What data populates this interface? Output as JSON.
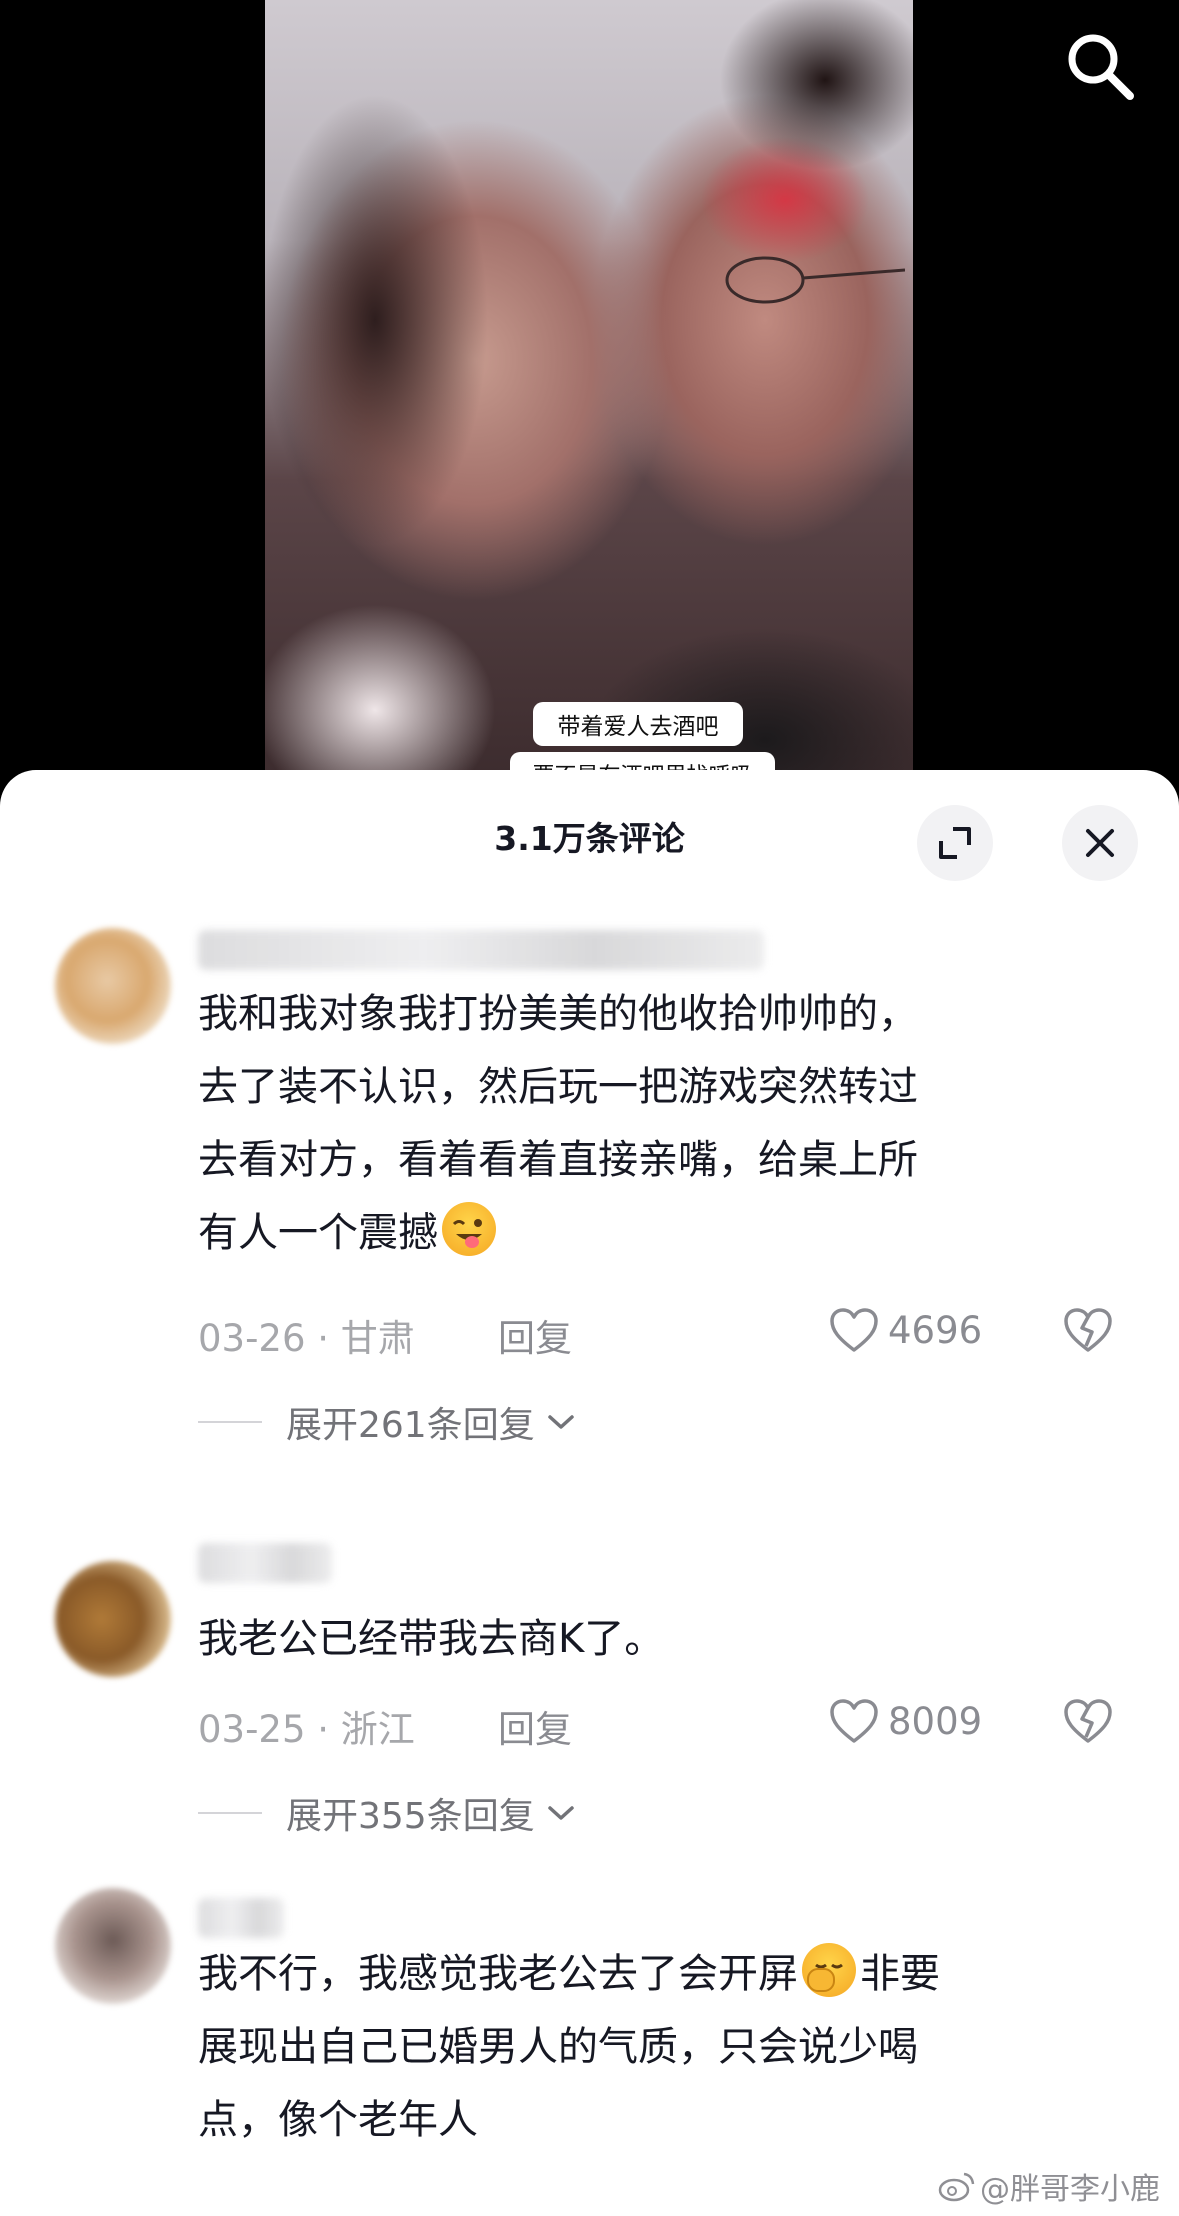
{
  "video": {
    "caption_line1": "带着爱人去酒吧",
    "caption_line2": "要不是在酒吧里找呼吸"
  },
  "icons": {
    "search": "search-icon",
    "expand": "expand-icon",
    "close": "close-icon",
    "like": "heart-outline-icon",
    "dislike": "broken-heart-icon",
    "chevron": "chevron-down-icon"
  },
  "comments_panel": {
    "title": "3.1万条评论",
    "comments": [
      {
        "text": "我和我对象我打扮美美的他收拾帅帅的，去了装不认识，然后玩一把游戏突然转过去看对方，看着看着直接亲嘴，给桌上所有人一个震撼",
        "lines": [
          "我和我对象我打扮美美的他收拾帅帅的，",
          "去了装不认识，然后玩一把游戏突然转过",
          "去看对方，看着看着直接亲嘴，给桌上所",
          "有人一个震撼"
        ],
        "emoji": "winking-tongue-emoji",
        "date_location": "03-26 · 甘肃",
        "reply_label": "回复",
        "likes": "4696",
        "expand_replies": "展开261条回复"
      },
      {
        "text": "我老公已经带我去商K了。",
        "lines": [
          "我老公已经带我去商K了。"
        ],
        "date_location": "03-25 · 浙江",
        "reply_label": "回复",
        "likes": "8009",
        "expand_replies": "展开355条回复"
      },
      {
        "text": "我不行，我感觉我老公去了会开屏非要展现出自己已婚男人的气质，只会说少喝点，像个老年人",
        "lines": [
          "我不行，我感觉我老公去了会开屏",
          "展现出自己已婚男人的气质，只会说少喝",
          "点，像个老年人"
        ],
        "line1_suffix": "非要",
        "emoji": "face-palm-emoji"
      }
    ]
  },
  "watermark": "@胖哥李小鹿",
  "colors": {
    "text_primary": "#161823",
    "text_secondary": "#8a8b91",
    "sheet_bg": "#ffffff",
    "button_bg": "#f2f2f4"
  }
}
